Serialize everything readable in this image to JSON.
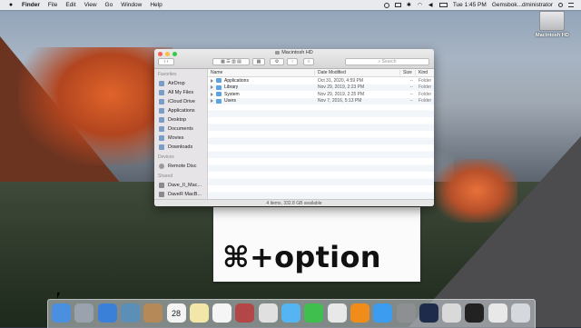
{
  "menubar": {
    "apple": "",
    "items": [
      "Finder",
      "File",
      "Edit",
      "View",
      "Go",
      "Window",
      "Help"
    ],
    "time": "Tue 1:45 PM",
    "user": "Gemsbok...dministrator"
  },
  "desktop": {
    "disk_label": "Macintosh HD"
  },
  "finder": {
    "title": "Macintosh HD",
    "search_placeholder": "Search",
    "sidebar": {
      "favorites_header": "Favorites",
      "favorites": [
        "AirDrop",
        "All My Files",
        "iCloud Drive",
        "Applications",
        "Desktop",
        "Documents",
        "Movies",
        "Downloads"
      ],
      "devices_header": "Devices",
      "devices": [
        "Remote Disc"
      ],
      "shared_header": "Shared",
      "shared": [
        "Dave_II_Mac...",
        "DaveR MacB..."
      ]
    },
    "columns": {
      "name": "Name",
      "date": "Date Modified",
      "size": "Size",
      "kind": "Kind"
    },
    "rows": [
      {
        "name": "Applications",
        "date": "Oct 31, 2020, 4:59 PM",
        "size": "--",
        "kind": "Folder"
      },
      {
        "name": "Library",
        "date": "Nov 29, 2019, 2:23 PM",
        "size": "--",
        "kind": "Folder"
      },
      {
        "name": "System",
        "date": "Nov 29, 2019, 2:25 PM",
        "size": "--",
        "kind": "Folder"
      },
      {
        "name": "Users",
        "date": "Nov 7, 2016, 5:13 PM",
        "size": "--",
        "kind": "Folder"
      }
    ],
    "status": "4 items, 332.8 GB available"
  },
  "overlay": {
    "shortcut": "⌘+option"
  },
  "dock": {
    "apps": [
      {
        "name": "finder-icon",
        "color": "#4a8fe0"
      },
      {
        "name": "launchpad-icon",
        "color": "#9aa3ad"
      },
      {
        "name": "safari-icon",
        "color": "#3a7fd8"
      },
      {
        "name": "preview-icon",
        "color": "#5b8fb8"
      },
      {
        "name": "contacts-icon",
        "color": "#b58a58"
      },
      {
        "name": "calendar-icon",
        "color": "#f4f4f4"
      },
      {
        "name": "notes-icon",
        "color": "#f2e6a8"
      },
      {
        "name": "reminders-icon",
        "color": "#f5f5f5"
      },
      {
        "name": "photo-booth-icon",
        "color": "#b34747"
      },
      {
        "name": "photos-icon",
        "color": "#e0e0e0"
      },
      {
        "name": "messages-icon",
        "color": "#55b5f2"
      },
      {
        "name": "facetime-icon",
        "color": "#3fbf4e"
      },
      {
        "name": "itunes-icon",
        "color": "#e8e8e8"
      },
      {
        "name": "ibooks-icon",
        "color": "#f08c1a"
      },
      {
        "name": "app-store-icon",
        "color": "#3b9cf0"
      },
      {
        "name": "system-preferences-icon",
        "color": "#8d8f93"
      },
      {
        "name": "quicktime-icon",
        "color": "#1e2b4a"
      },
      {
        "name": "chrome-icon",
        "color": "#d9d9d9"
      },
      {
        "name": "terminal-icon",
        "color": "#222222"
      },
      {
        "name": "document-icon",
        "color": "#e8e8e8"
      },
      {
        "name": "trash-icon",
        "color": "#d5d8dc"
      }
    ],
    "calendar_day": "28"
  }
}
